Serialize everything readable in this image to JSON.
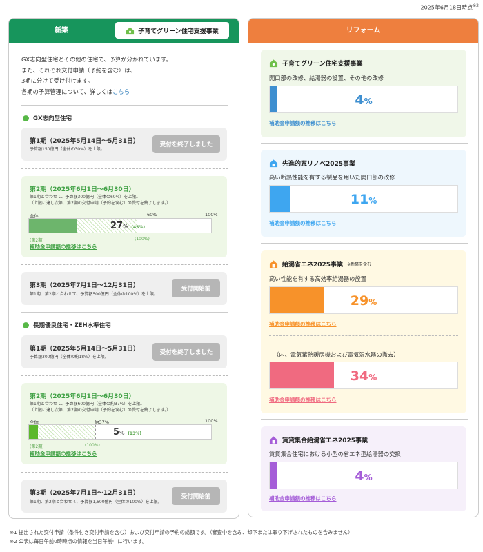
{
  "timestamp": "2025年6月18日時点",
  "timestamp_note": "※2",
  "left": {
    "title": "新築",
    "program_tag": "子育てグリーン住宅支援事業",
    "intro": [
      "GX志向型住宅とその他の住宅で、予算が分かれています。",
      "また、それぞれ交付申請（予約を含む）は、",
      "3期に分けて受け付けます。"
    ],
    "intro_last": "各期の予算管理について、詳しくは",
    "intro_link": "こちら",
    "gx": {
      "category": "GX志向型住宅",
      "p1": {
        "title": "第1期（2025年5月14日〜5月31日）",
        "note": "予算額150億円（全体の30%）を上限。",
        "status": "受付を終了しました"
      },
      "p2": {
        "title": "第2期（2025年6月1日〜6月30日）",
        "note": "第1期と合わせて、予算額300億円（全体の60%）を上限。\n（上限に達し次第、第2期の交付申請（予約を含む）の受付を終了します。）",
        "label_all": "全体",
        "label_mid": "60%",
        "label_full": "100%",
        "pct": "27",
        "pct_unit": "%",
        "sub": "(45%)",
        "label_period": "(第2期)",
        "label_period_full": "(100%)",
        "link": "補助金申請額の推移はこちら"
      },
      "p3": {
        "title": "第3期（2025年7月1日〜12月31日）",
        "note": "第1期、第2期と合わせて、予算額500億円（全体の100%）を上限。",
        "status": "受付開始前"
      }
    },
    "long": {
      "category": "長期優良住宅・ZEH水準住宅",
      "p1": {
        "title": "第1期（2025年5月14日〜5月31日）",
        "note": "予算額300億円（全体の約18%）を上限。",
        "status": "受付を終了しました"
      },
      "p2": {
        "title": "第2期（2025年6月1日〜6月30日）",
        "note": "第1期と合わせて、予算額600億円（全体の約37%）を上限。\n（上限に達し次第、第2期の交付申請（予約を含む）の受付を終了します。）",
        "label_all": "全体",
        "label_mid": "約37%",
        "label_full": "100%",
        "pct": "5",
        "pct_unit": "%",
        "sub": "(13%)",
        "label_period": "(第2期)",
        "label_period_full": "(100%)",
        "link": "補助金申請額の推移はこちら"
      },
      "p3": {
        "title": "第3期（2025年7月1日〜12月31日）",
        "note": "第1期、第2期と合わせて、予算額1,600億円（全体の100%）を上限。",
        "status": "受付開始前"
      }
    }
  },
  "right": {
    "title": "リフォーム",
    "items": [
      {
        "title": "子育てグリーン住宅支援事業",
        "desc": "開口部の改修、給湯器の設置、その他の改修",
        "pct": "4",
        "unit": "%",
        "progress": 0.04,
        "color": "#3e8fd0",
        "bg": "#f0f7e9",
        "link": "補助金申請額の推移はこちら"
      },
      {
        "title": "先進的窓リノベ2025事業",
        "desc": "高い断熱性能を有する製品を用いた開口部の改修",
        "pct": "11",
        "unit": "%",
        "progress": 0.11,
        "color": "#3ea6f0",
        "bg": "#eef7fd",
        "link": "補助金申請額の推移はこちら"
      },
      {
        "title": "給湯省エネ2025事業",
        "sup": "※新築を含む",
        "desc": "高い性能を有する高効率給湯器の設置",
        "pct": "29",
        "unit": "%",
        "progress": 0.29,
        "color": "#f7922a",
        "bg": "#fff9e3",
        "link": "補助金申請額の推移はこちら",
        "sub_desc": "（内、電気蓄熱暖房機および電気温水器の撤去）",
        "sub_pct": "34",
        "sub_progress": 0.34,
        "sub_color": "#f06a80",
        "sub_link": "補助金申請額の推移はこちら"
      },
      {
        "title": "賃貸集合給湯省エネ2025事業",
        "desc": "賃貸集合住宅における小型の省エネ型給湯器の交換",
        "pct": "4",
        "unit": "%",
        "progress": 0.04,
        "color": "#a55dd8",
        "bg": "#f6f0fa",
        "link": "補助金申請額の推移はこちら"
      }
    ]
  },
  "footnotes": [
    "※1 提出された交付申請（条件付き交付申請を含む）および交付申請の予約の総額です。（審査中を含み、却下または取り下げされたものを含みません）",
    "※2 公表は毎日午前0時時点の情報を当日午前中に行います。"
  ],
  "colors": {
    "green": "#17955c",
    "orange": "#ee7f3e",
    "bar_green": "#5aa64e",
    "gx_fill": "#6db56c",
    "long_fill": "#5cb82c"
  }
}
